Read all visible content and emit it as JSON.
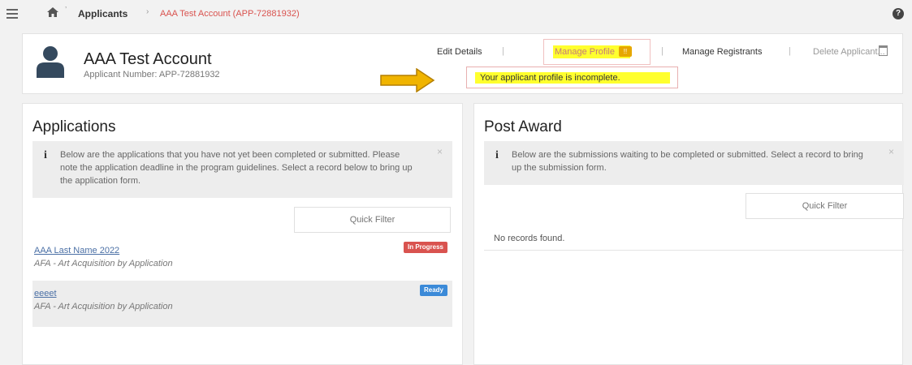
{
  "breadcrumb": {
    "applicants": "Applicants",
    "current": "AAA Test Account (APP-72881932)"
  },
  "header": {
    "name": "AAA Test Account",
    "number": "Applicant Number: APP-72881932",
    "actions": {
      "edit": "Edit Details",
      "manage_profile": "Manage Profile",
      "manage_registrants": "Manage Registrants",
      "delete": "Delete Applicant..."
    },
    "tooltip": "Your applicant profile is incomplete."
  },
  "applications": {
    "title": "Applications",
    "info": "Below are the applications that you have not yet been completed or submitted. Please note the application deadline in the program guidelines. Select a record below to bring up the application form.",
    "filter_placeholder": "Quick Filter",
    "rows": [
      {
        "title": "AAA Last Name 2022",
        "subtitle": "AFA - Art Acquisition by Application",
        "status": "In Progress",
        "status_color": "#d9534f"
      },
      {
        "title": "eeeet",
        "subtitle": "AFA - Art Acquisition by Application",
        "status": "Ready",
        "status_color": "#3b8ad8"
      }
    ]
  },
  "post_award": {
    "title": "Post Award",
    "info": "Below are the submissions waiting to be completed or submitted. Select a record to bring up the submission form.",
    "filter_placeholder": "Quick Filter",
    "empty": "No records found."
  },
  "icons": {
    "menu": "hamburger-icon",
    "home": "home-icon",
    "help": "help-icon",
    "avatar": "user-icon",
    "info": "info-icon",
    "close": "close-icon",
    "delete": "trash-icon",
    "arrow": "arrow-right-icon"
  },
  "colors": {
    "highlight": "#ffff2e",
    "arrow": "#f0b400",
    "in_progress": "#d9534f",
    "ready": "#3b8ad8"
  }
}
